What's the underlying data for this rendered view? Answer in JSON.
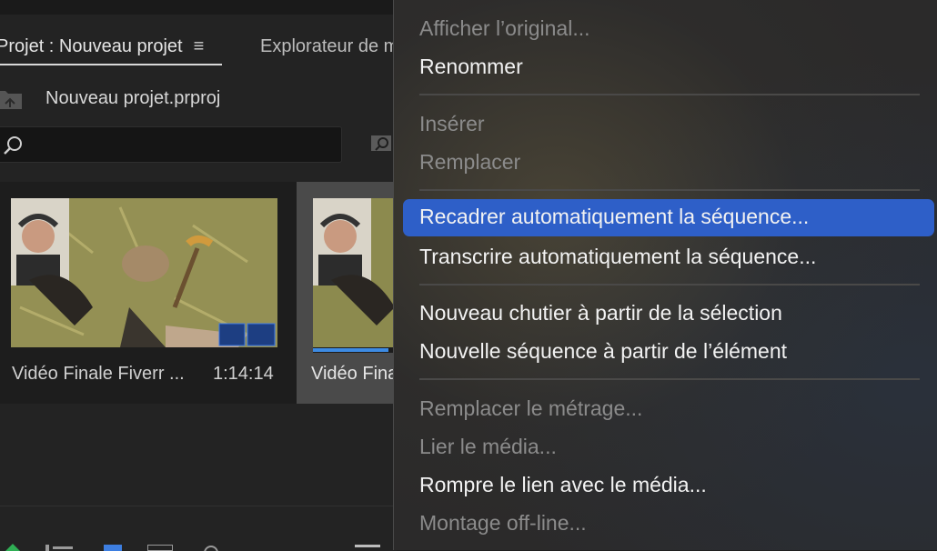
{
  "panel": {
    "tab_project": "Projet : Nouveau projet",
    "tab_menu_icon": "≡",
    "tab_explorer": "Explorateur de m",
    "project_file": "Nouveau projet.prproj",
    "search": {
      "value": "",
      "placeholder": ""
    },
    "clips": [
      {
        "name": "Vidéo Finale Fiverr ...",
        "duration": "1:14:14"
      },
      {
        "name": "Vidéo Fina"
      }
    ],
    "clip2_progress": 0.9,
    "icons": [
      "folder-up-icon",
      "search-icon",
      "new-bin-icon",
      "video-badge-icon",
      "audio-badge-icon",
      "pen-icon",
      "list-view-icon",
      "icon-view-icon",
      "freeform-view-icon",
      "zoom-icon",
      "hamburger-icon"
    ]
  },
  "menu": {
    "items": [
      {
        "label": "Afficher l’original...",
        "enabled": false
      },
      {
        "label": "Renommer",
        "enabled": true
      },
      {
        "label": "Insérer",
        "enabled": false
      },
      {
        "label": "Remplacer",
        "enabled": false
      },
      {
        "label": "Recadrer automatiquement la séquence...",
        "enabled": true,
        "highlighted": true
      },
      {
        "label": "Transcrire automatiquement la séquence...",
        "enabled": true
      },
      {
        "label": "Nouveau chutier à partir de la sélection",
        "enabled": true
      },
      {
        "label": "Nouvelle séquence à partir de l’élément",
        "enabled": true
      },
      {
        "label": "Remplacer le métrage...",
        "enabled": false
      },
      {
        "label": "Lier le média...",
        "enabled": false
      },
      {
        "label": "Rompre le lien avec le média...",
        "enabled": true
      },
      {
        "label": "Montage off-line...",
        "enabled": false
      }
    ],
    "colors": {
      "highlight": "#2e5fc8",
      "enabled_text": "#f2f2f2",
      "disabled_text": "#8b8b8b"
    }
  }
}
